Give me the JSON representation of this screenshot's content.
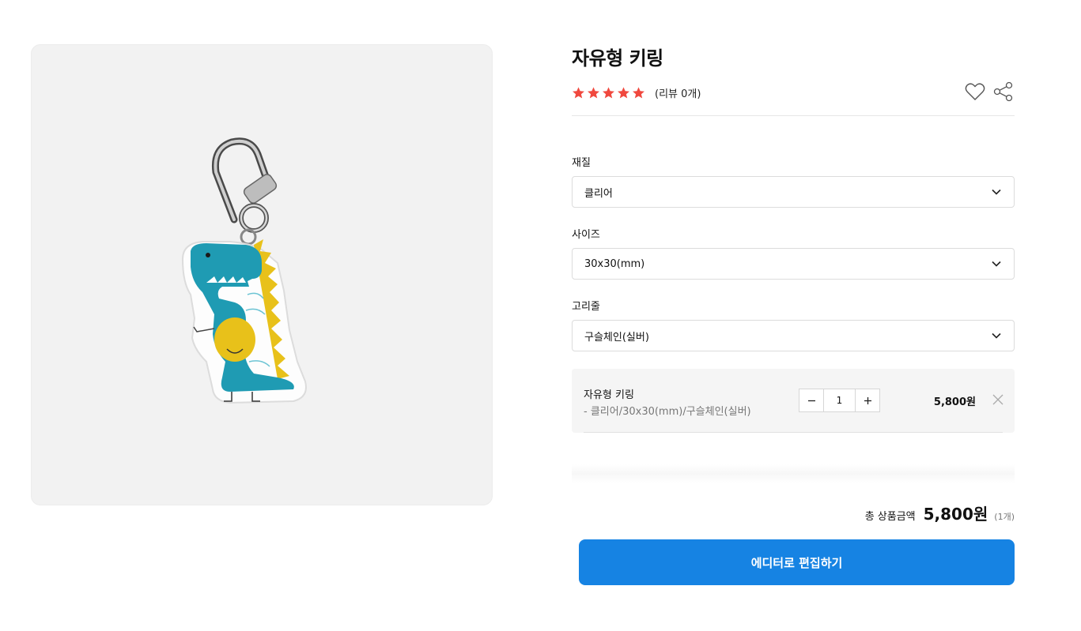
{
  "product": {
    "title": "자유형 키링",
    "rating": 5,
    "review_count_text": "(리뷰 0개)",
    "image_icon": "dinosaur-keyring-image"
  },
  "actions": {
    "wishlist_icon": "heart-icon",
    "share_icon": "share-icon"
  },
  "options": [
    {
      "label": "재질",
      "value": "클리어"
    },
    {
      "label": "사이즈",
      "value": "30x30(mm)"
    },
    {
      "label": "고리줄",
      "value": "구슬체인(실버)"
    }
  ],
  "selected_item": {
    "name": "자유형 키링",
    "detail": "- 클리어/30x30(mm)/구슬체인(실버)",
    "quantity": "1",
    "price": "5,800원"
  },
  "total": {
    "label": "총 상품금액",
    "price": "5,800원",
    "count": "(1개)"
  },
  "cta": {
    "label": "에디터로 편집하기"
  },
  "colors": {
    "accent": "#1683e3",
    "star": "#f0483e",
    "panel_bg": "#f2f2f2"
  }
}
